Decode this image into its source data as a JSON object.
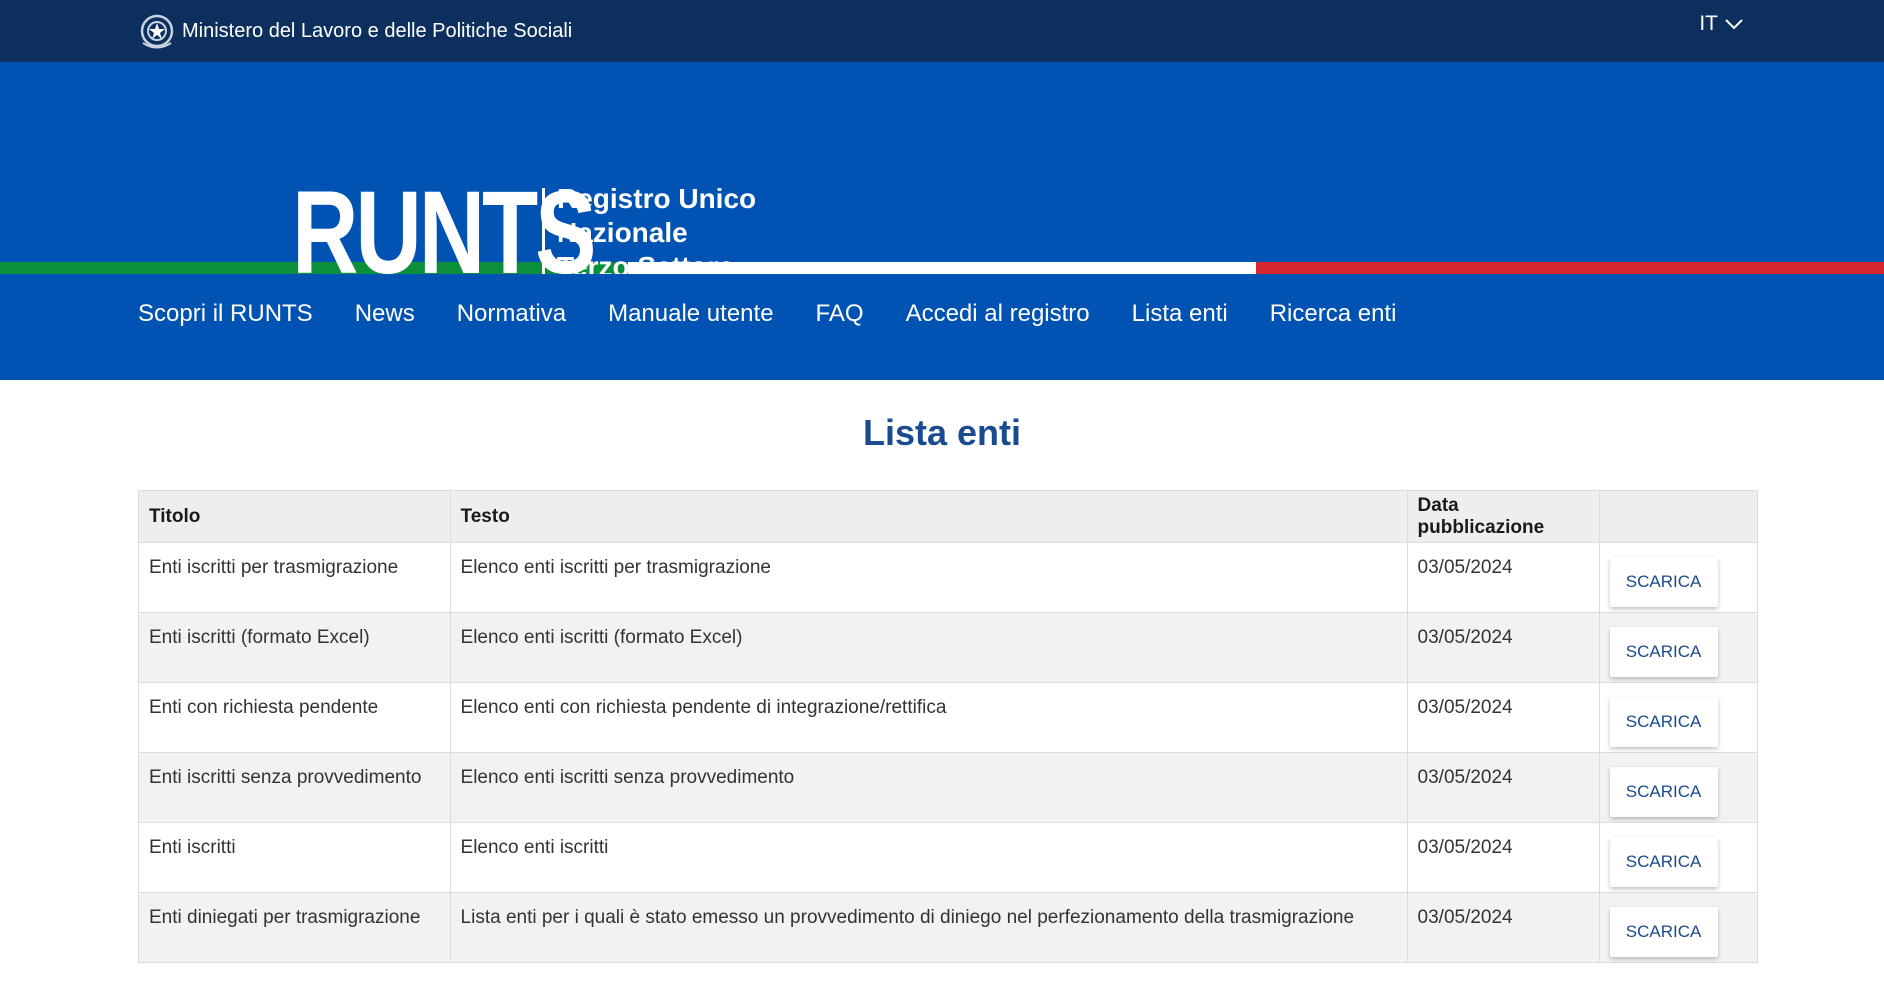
{
  "topbar": {
    "ministry": "Ministero del Lavoro e delle Politiche Sociali",
    "emblem_icon": "italian-republic-emblem-icon",
    "language": "IT",
    "language_icon": "chevron-down-icon"
  },
  "header": {
    "logo": "RUNTS",
    "subtitle_line1": "Registro Unico",
    "subtitle_line2": "Nazionale",
    "subtitle_line3": "Terzo Settore"
  },
  "colors": {
    "topbar": "#0d2f5e",
    "header": "#0153b3",
    "title": "#1a4a8f",
    "flag_green": "#0b8f3b",
    "flag_white": "#ffffff",
    "flag_red": "#d8282f"
  },
  "nav": {
    "items": [
      "Scopri il RUNTS",
      "News",
      "Normativa",
      "Manuale utente",
      "FAQ",
      "Accedi al registro",
      "Lista enti",
      "Ricerca enti"
    ]
  },
  "main": {
    "title": "Lista enti",
    "table": {
      "headers": [
        "Titolo",
        "Testo",
        "Data pubblicazione",
        ""
      ],
      "rows": [
        {
          "titolo": "Enti iscritti per trasmigrazione",
          "testo": "Elenco enti iscritti per trasmigrazione",
          "data": "03/05/2024",
          "action": "SCARICA"
        },
        {
          "titolo": "Enti iscritti (formato Excel)",
          "testo": "Elenco enti iscritti (formato Excel)",
          "data": "03/05/2024",
          "action": "SCARICA"
        },
        {
          "titolo": "Enti con richiesta pendente",
          "testo": "Elenco enti con richiesta pendente di integrazione/rettifica",
          "data": "03/05/2024",
          "action": "SCARICA"
        },
        {
          "titolo": "Enti iscritti senza provvedimento",
          "testo": "Elenco enti iscritti senza provvedimento",
          "data": "03/05/2024",
          "action": "SCARICA"
        },
        {
          "titolo": "Enti iscritti",
          "testo": "Elenco enti iscritti",
          "data": "03/05/2024",
          "action": "SCARICA"
        },
        {
          "titolo": "Enti diniegati per trasmigrazione",
          "testo": "Lista enti per i quali è stato emesso un provvedimento di diniego nel perfezionamento della trasmigrazione",
          "data": "03/05/2024",
          "action": "SCARICA"
        }
      ]
    }
  }
}
